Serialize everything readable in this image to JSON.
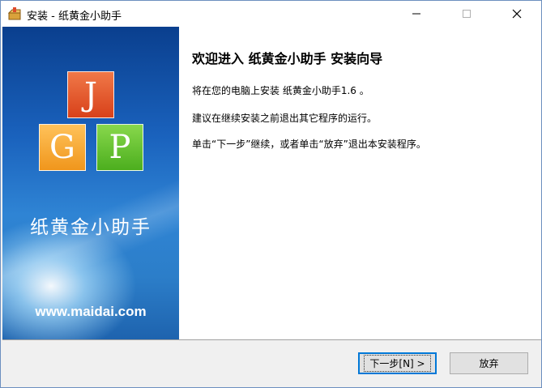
{
  "window": {
    "title": "安装 - 纸黄金小助手",
    "minimize_icon": "minimize-icon",
    "maximize_icon": "maximize-icon",
    "close_icon": "close-icon"
  },
  "banner": {
    "tiles": [
      "J",
      "G",
      "P"
    ],
    "tile_colors": {
      "J": "#e0582c",
      "G": "#f5a32e",
      "P": "#62c12f"
    },
    "product_name": "纸黄金小助手",
    "website": "www.maidai.com"
  },
  "content": {
    "heading": "欢迎进入 纸黄金小助手 安装向导",
    "line1": "将在您的电脑上安装 纸黄金小助手1.6 。",
    "line2": "建议在继续安装之前退出其它程序的运行。",
    "line3": "单击“下一步”继续，或者单击“放弃”退出本安装程序。"
  },
  "buttons": {
    "next": "下一步[N] >",
    "cancel": "放弃"
  }
}
